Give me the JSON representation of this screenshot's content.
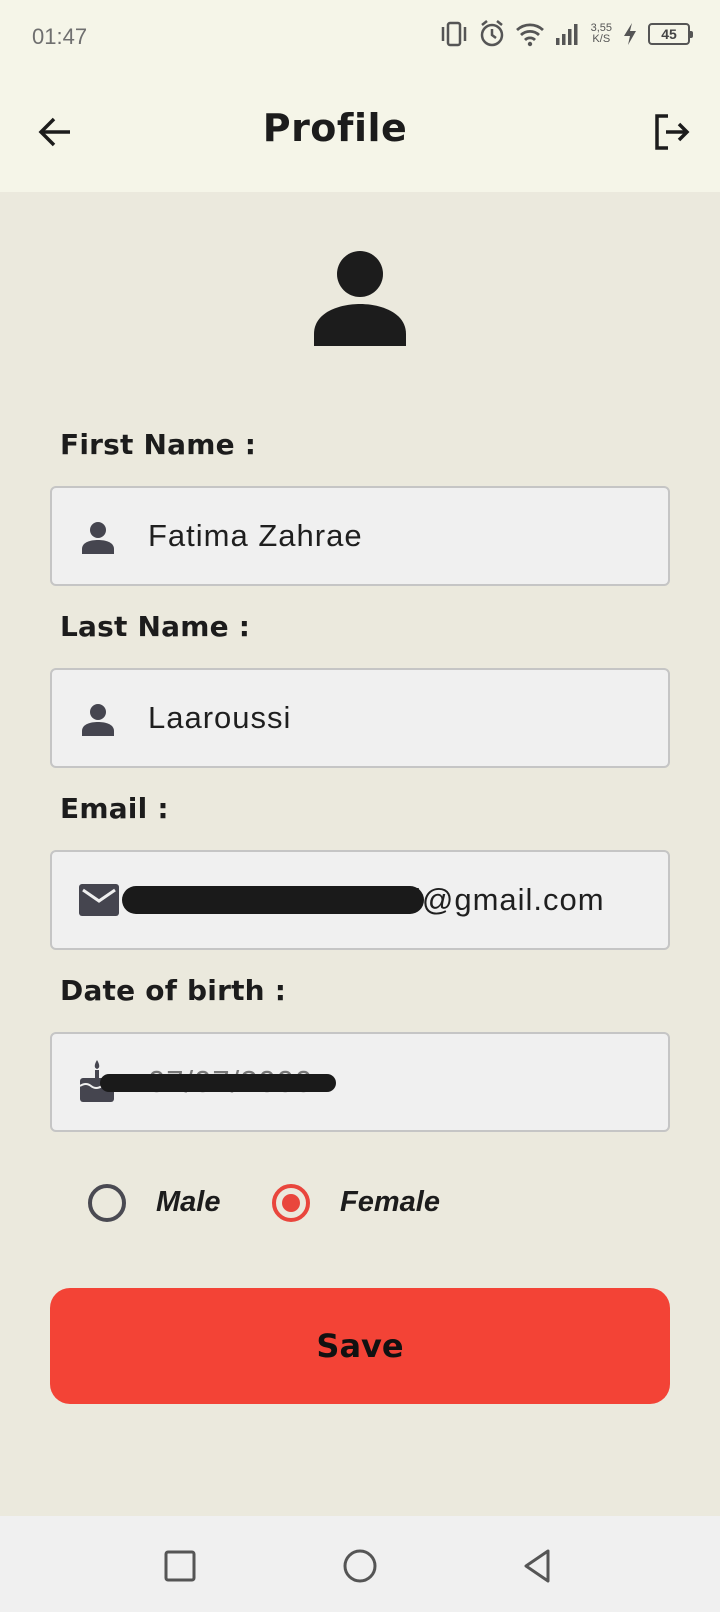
{
  "status_bar": {
    "time": "01:47",
    "speed_value": "3,55",
    "speed_unit": "K/S",
    "battery": "45"
  },
  "header": {
    "title": "Profile",
    "back_icon": "arrow-left-icon",
    "logout_icon": "logout-icon"
  },
  "avatar_icon": "person-icon",
  "form": {
    "first_name": {
      "label": "First Name :",
      "value": "Fatima Zahrae",
      "icon": "person-icon"
    },
    "last_name": {
      "label": "Last Name :",
      "value": "Laaroussi",
      "icon": "person-icon"
    },
    "email": {
      "label": "Email :",
      "value_visible": "l@gmail.com",
      "icon": "mail-icon"
    },
    "dob": {
      "label": "Date of birth :",
      "value": "07/07/2000",
      "icon": "cake-icon"
    }
  },
  "gender": {
    "options": [
      "Male",
      "Female"
    ],
    "selected": "Female"
  },
  "save_label": "Save",
  "colors": {
    "accent": "#f34336",
    "background": "#ebe9dd",
    "bar_background": "#f5f5e8"
  },
  "navigation_bar": {
    "buttons": [
      "recents-square-icon",
      "home-circle-icon",
      "back-triangle-icon"
    ]
  }
}
